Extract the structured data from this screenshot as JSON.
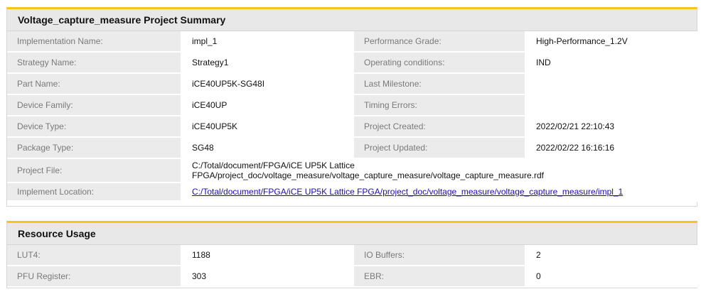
{
  "summary": {
    "title": "Voltage_capture_measure Project Summary",
    "rows": [
      {
        "l1": "Implementation Name:",
        "v1": "impl_1",
        "l2": "Performance Grade:",
        "v2": "High-Performance_1.2V"
      },
      {
        "l1": "Strategy Name:",
        "v1": "Strategy1",
        "l2": "Operating conditions:",
        "v2": "IND"
      },
      {
        "l1": "Part Name:",
        "v1": "iCE40UP5K-SG48I",
        "l2": "Last Milestone:",
        "v2": ""
      },
      {
        "l1": "Device Family:",
        "v1": "iCE40UP",
        "l2": "Timing Errors:",
        "v2": ""
      },
      {
        "l1": "Device Type:",
        "v1": "iCE40UP5K",
        "l2": "Project Created:",
        "v2": "2022/02/21 22:10:43"
      },
      {
        "l1": "Package Type:",
        "v1": "SG48",
        "l2": "Project Updated:",
        "v2": "2022/02/22 16:16:16"
      }
    ],
    "project_file_label": "Project File:",
    "project_file_value": "C:/Total/document/FPGA/iCE UP5K Lattice FPGA/project_doc/voltage_measure/voltage_capture_measure/voltage_capture_measure.rdf",
    "implement_location_label": "Implement Location:",
    "implement_location_value": "C:/Total/document/FPGA/iCE UP5K Lattice FPGA/project_doc/voltage_measure/voltage_capture_measure/impl_1"
  },
  "resources": {
    "title": "Resource Usage",
    "rows": [
      {
        "l1": "LUT4:",
        "v1": "1188",
        "l2": "IO Buffers:",
        "v2": "2"
      },
      {
        "l1": "PFU Register:",
        "v1": "303",
        "l2": "EBR:",
        "v2": "0"
      }
    ]
  }
}
